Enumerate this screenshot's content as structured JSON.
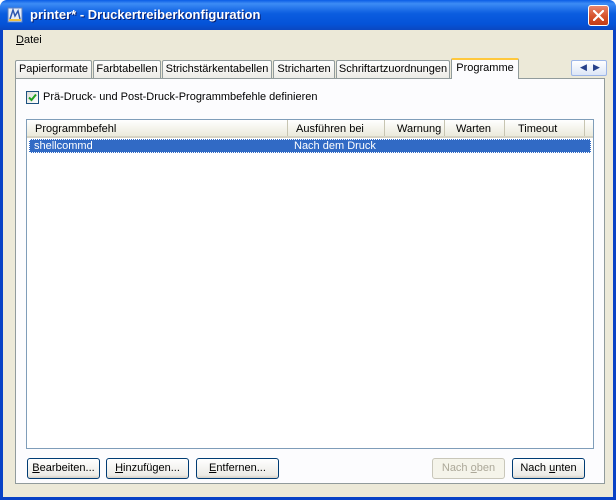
{
  "window": {
    "title": "printer* - Druckertreiberkonfiguration"
  },
  "menu": {
    "items": [
      {
        "label_underlined": "D",
        "label_rest": "atei"
      }
    ]
  },
  "tabs": [
    {
      "label": "Papierformate",
      "active": false
    },
    {
      "label": "Farbtabellen",
      "active": false
    },
    {
      "label": "Strichstärkentabellen",
      "active": false
    },
    {
      "label": "Stricharten",
      "active": false
    },
    {
      "label": "Schriftartzuordnungen",
      "active": false
    },
    {
      "label": "Programme",
      "active": true
    }
  ],
  "programme": {
    "checkbox_label": "Prä-Druck- und Post-Druck-Programmbefehle definieren",
    "checkbox_checked": true,
    "columns": [
      "Programmbefehl",
      "Ausführen bei",
      "Warnung",
      "Warten",
      "Timeout"
    ],
    "rows": [
      {
        "command": "shellcommd",
        "run_at": "Nach dem Druck",
        "warning": "",
        "wait": "",
        "timeout": "",
        "selected": true
      }
    ]
  },
  "buttons": {
    "edit": {
      "u": "B",
      "rest": "earbeiten..."
    },
    "add": {
      "u": "H",
      "rest": "inzufügen..."
    },
    "remove": {
      "u": "E",
      "rest": "ntfernen..."
    },
    "up": {
      "pre": "Nach ",
      "u": "o",
      "rest": "ben",
      "enabled": false
    },
    "down": {
      "pre": "Nach ",
      "u": "u",
      "rest": "nten",
      "enabled": true
    }
  },
  "colors": {
    "titlebar": "#0453d8",
    "selection": "#316ac5",
    "active_tab_accent": "#ffc83c"
  }
}
